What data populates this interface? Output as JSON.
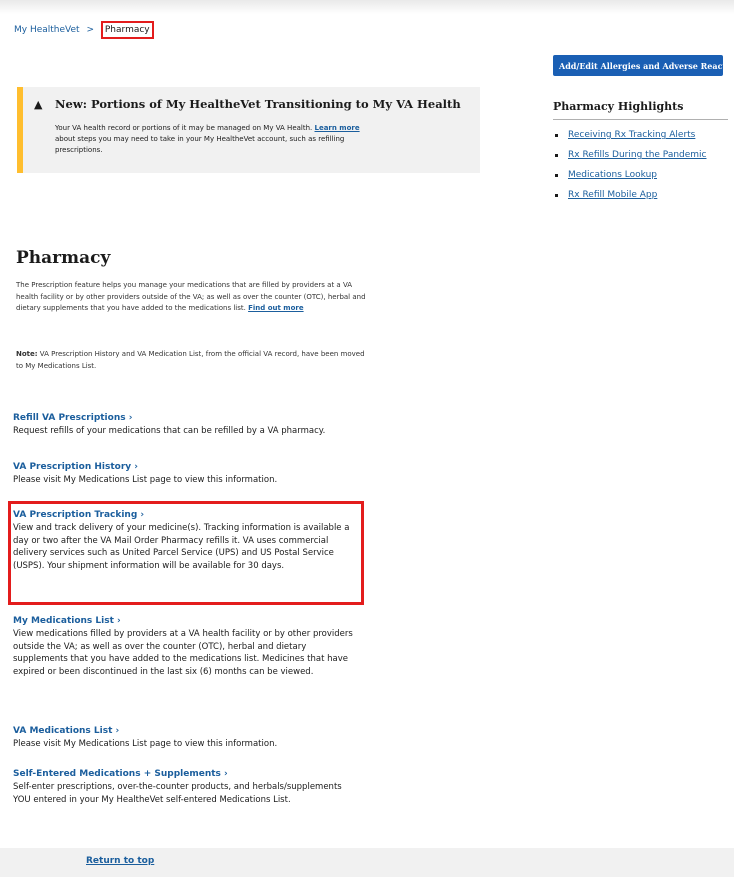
{
  "breadcrumb": {
    "home": "My HealtheVet",
    "separator": ">",
    "current": "Pharmacy"
  },
  "top_button": {
    "label": "Add/Edit Allergies and Adverse Reactions"
  },
  "alert": {
    "icon": "warning-icon",
    "title": "New: Portions of My HealtheVet Transitioning to My VA Health",
    "body_before": "Your VA health record or portions of it may be managed on My VA Health. ",
    "link": "Learn more",
    "body_after": " about steps you may need to take in your My HealtheVet account, such as refilling prescriptions."
  },
  "highlights": {
    "title": "Pharmacy Highlights",
    "items": [
      {
        "label": "Receiving Rx Tracking Alerts"
      },
      {
        "label": "Rx Refills During the Pandemic"
      },
      {
        "label": "Medications Lookup"
      },
      {
        "label": "Rx Refill Mobile App"
      }
    ]
  },
  "page": {
    "title": "Pharmacy",
    "intro": "The Prescription feature helps you manage your medications that are filled by providers at a VA health facility or by other providers outside of the VA; as well as over the counter (OTC), herbal and dietary supplements that you have added to the medications list. ",
    "intro_link": "Find out more",
    "note_label": "Note:",
    "note_text": " VA Prescription History and VA Medication List, from the official VA record, have been moved to My Medications List."
  },
  "sections": [
    {
      "link": "Refill VA Prescriptions ›",
      "desc": "Request refills of your medications that can be refilled by a VA pharmacy."
    },
    {
      "link": "VA Prescription History ›",
      "desc": "Please visit My Medications List page to view this information."
    },
    {
      "link": "VA Prescription Tracking ›",
      "desc": "View and track delivery of your medicine(s). Tracking information is available a day or two after the VA Mail Order Pharmacy refills it. VA uses commercial delivery services such as United Parcel Service (UPS) and US Postal Service (USPS). Your shipment information will be available for 30 days."
    },
    {
      "link": "My Medications List ›",
      "desc": "View medications filled by providers at a VA health facility or by other providers outside the VA; as well as over the counter (OTC), herbal and dietary supplements that you have added to the medications list. Medicines that have expired or been discontinued in the last six (6) months can be viewed."
    },
    {
      "link": "VA Medications List ›",
      "desc": "Please visit My Medications List page to view this information."
    },
    {
      "link": "Self-Entered Medications + Supplements ›",
      "desc": "Self-enter prescriptions, over-the-counter products, and herbals/supplements YOU entered in your My HealtheVet self-entered Medications List."
    }
  ],
  "footer": {
    "return_to_top": "Return to top"
  },
  "colors": {
    "link": "#1b5e9d",
    "accent_button": "#1a5fb4",
    "alert_bar": "#ffbe2e",
    "highlight_border": "#e31c1c"
  }
}
